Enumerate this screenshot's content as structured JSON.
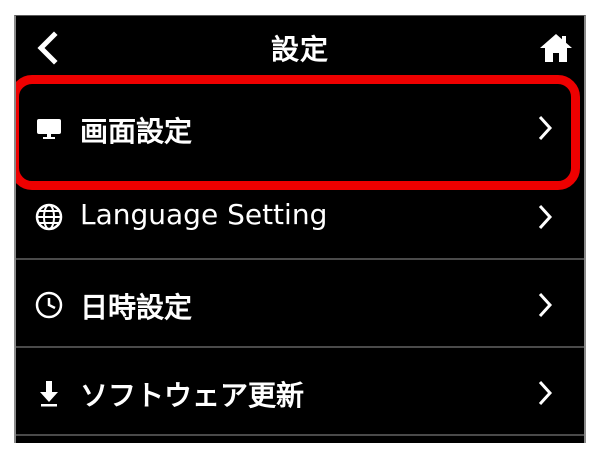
{
  "header": {
    "title": "設定",
    "back_icon": "chevron-left-icon",
    "home_icon": "home-icon"
  },
  "menu": {
    "items": [
      {
        "label": "画面設定",
        "icon": "monitor-icon",
        "highlighted": true
      },
      {
        "label": "Language Setting",
        "icon": "globe-icon",
        "highlighted": false
      },
      {
        "label": "日時設定",
        "icon": "clock-icon",
        "highlighted": false
      },
      {
        "label": "ソフトウェア更新",
        "icon": "download-arrow-icon",
        "highlighted": false
      }
    ]
  },
  "colors": {
    "background": "#000000",
    "text": "#ffffff",
    "highlight": "#ee0000",
    "divider": "#4a4a4a"
  }
}
